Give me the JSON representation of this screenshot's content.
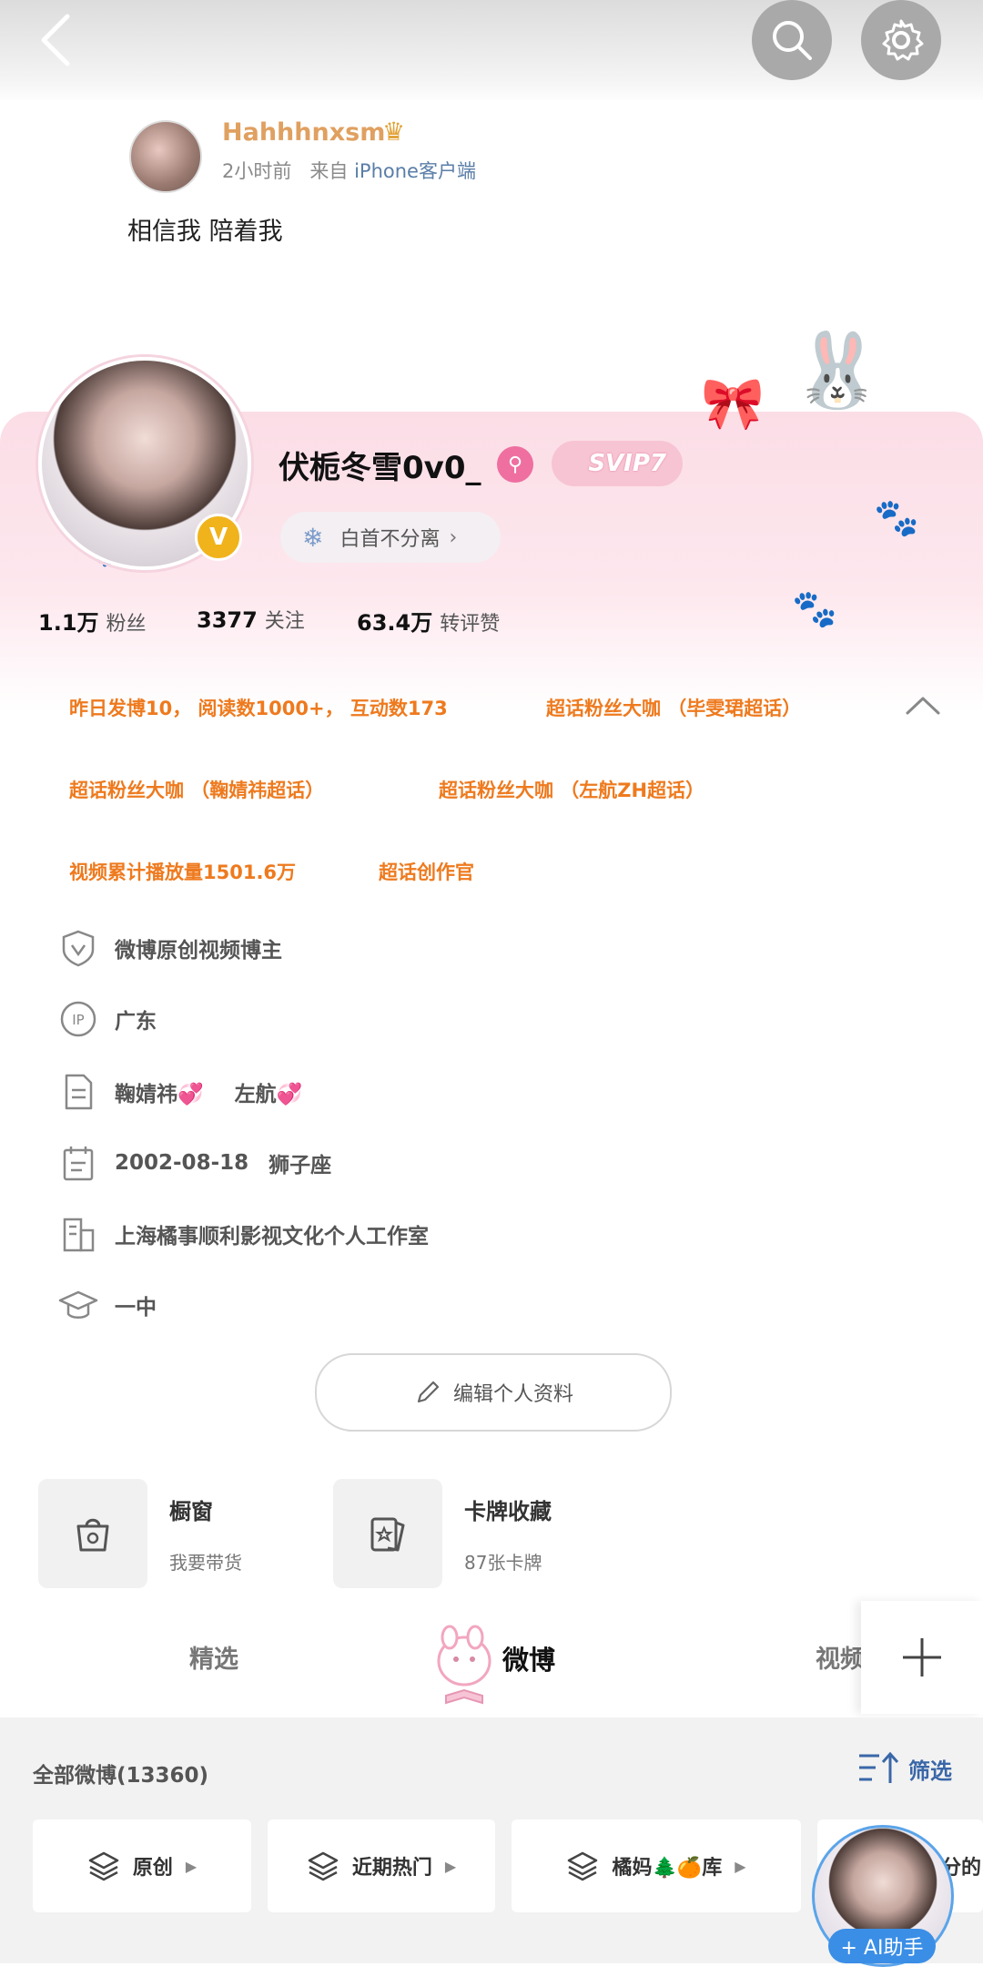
{
  "post": {
    "author": "Hahhhnxsm",
    "time": "2小时前",
    "from_prefix": "来自",
    "source": "iPhone客户端",
    "text": "相信我 陪着我"
  },
  "profile": {
    "nickname": "伏栀冬雪0v0_",
    "svip": "SVIP7",
    "verified_badge": "V",
    "group": "白首不分离"
  },
  "stats": [
    {
      "value": "1.1万",
      "label": "粉丝"
    },
    {
      "value": "3377",
      "label": "关注"
    },
    {
      "value": "63.4万",
      "label": "转评赞"
    }
  ],
  "honors": [
    "昨日发博10， 阅读数1000+， 互动数173",
    "超话粉丝大咖 （毕雯珺超话）",
    "超话粉丝大咖 （鞠婧祎超话）",
    "超话粉丝大咖 （左航ZH超话）",
    "视频累计播放量1501.6万",
    "超话创作官"
  ],
  "info": {
    "verification": "微博原创视频博主",
    "ip": "广东",
    "bio_a": "鞠婧祎💞",
    "bio_b": "左航💞",
    "birthday": "2002-08-18",
    "zodiac": "狮子座",
    "company": "上海橘事顺利影视文化个人工作室",
    "school": "一中",
    "ip_icon_text": "IP"
  },
  "edit_profile": "编辑个人资料",
  "cards": [
    {
      "title": "橱窗",
      "sub": "我要带货",
      "icon": "shopping-bag-icon"
    },
    {
      "title": "卡牌收藏",
      "sub": "87张卡牌",
      "icon": "card-icon"
    }
  ],
  "tabs": [
    "精选",
    "微博",
    "视频"
  ],
  "feed": {
    "title": "全部微博(13360)",
    "filter": "筛选",
    "chips": [
      "原创",
      "近期热门",
      "橘妈🌲🍊库",
      "分的"
    ]
  },
  "ai_assistant": "+ AI助手",
  "colors": {
    "honor": "#ee7a1e",
    "link": "#3a67a8",
    "pink_bg": "#fbdde6",
    "ai_blue": "#3a8ee6"
  }
}
